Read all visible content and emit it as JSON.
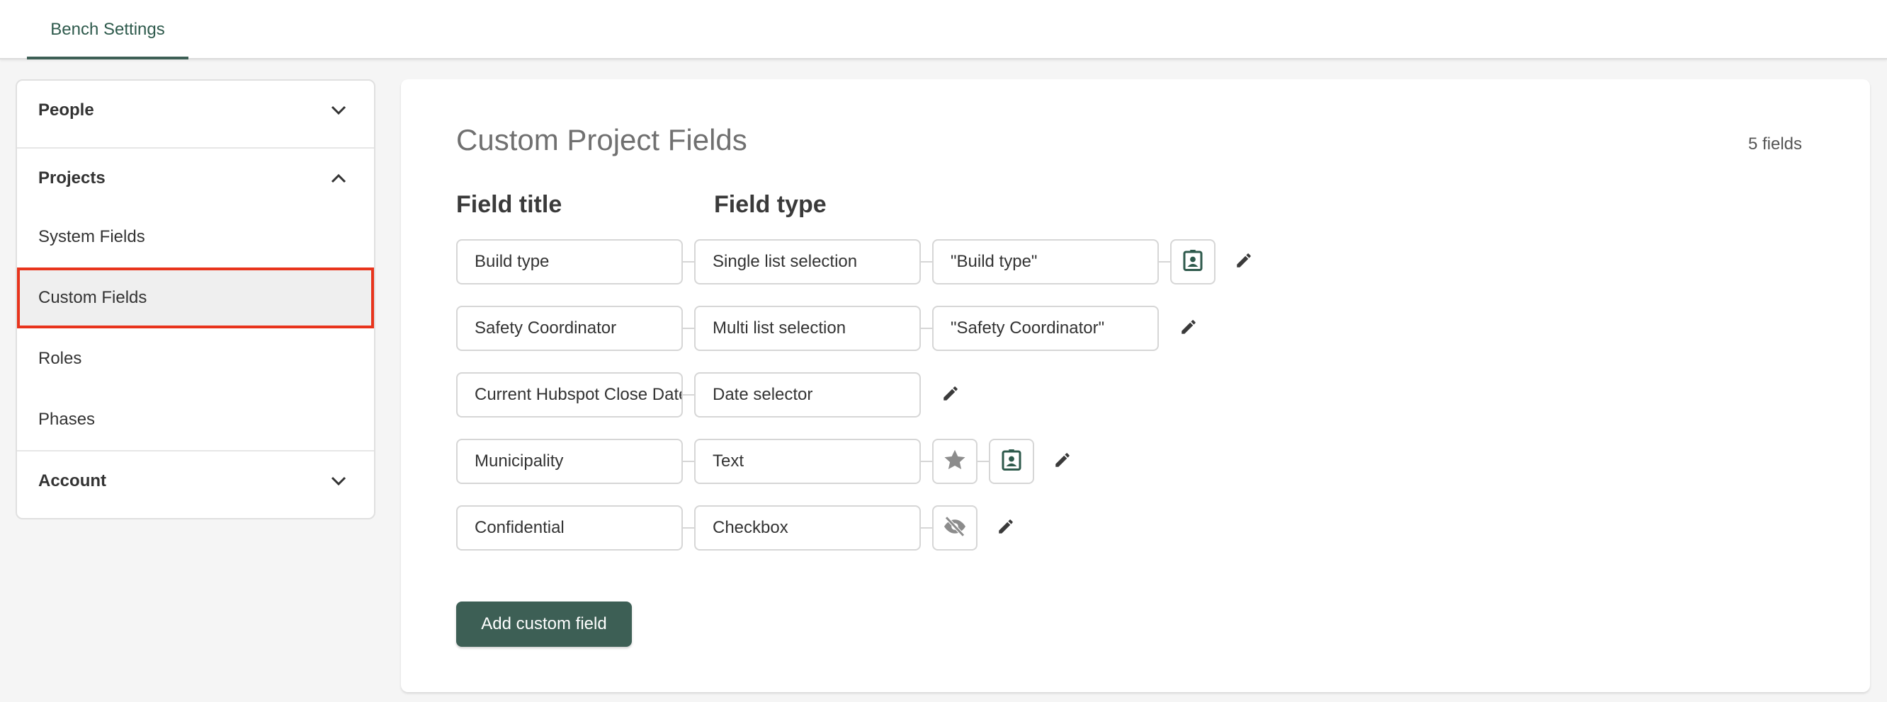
{
  "topbar": {
    "tab_label": "Bench Settings"
  },
  "sidebar": {
    "people": "People",
    "projects": "Projects",
    "system_fields": "System Fields",
    "custom_fields": "Custom Fields",
    "roles": "Roles",
    "phases": "Phases",
    "account": "Account"
  },
  "main": {
    "title": "Custom Project Fields",
    "count": "5 fields",
    "col_title": "Field title",
    "col_type": "Field type",
    "add_button": "Add custom field",
    "rows": [
      {
        "title": "Build type",
        "type": "Single list selection",
        "extra": "\"Build type\""
      },
      {
        "title": "Safety Coordinator",
        "type": "Multi list selection",
        "extra": "\"Safety Coordinator\""
      },
      {
        "title": "Current Hubspot Close Date",
        "type": "Date selector"
      },
      {
        "title": "Municipality",
        "type": "Text"
      },
      {
        "title": "Confidential",
        "type": "Checkbox"
      }
    ]
  },
  "colors": {
    "accent": "#3d5f55",
    "highlight": "#e8341c",
    "badge_icon": "#2e5a4c",
    "muted_icon": "#8c8c8c"
  }
}
